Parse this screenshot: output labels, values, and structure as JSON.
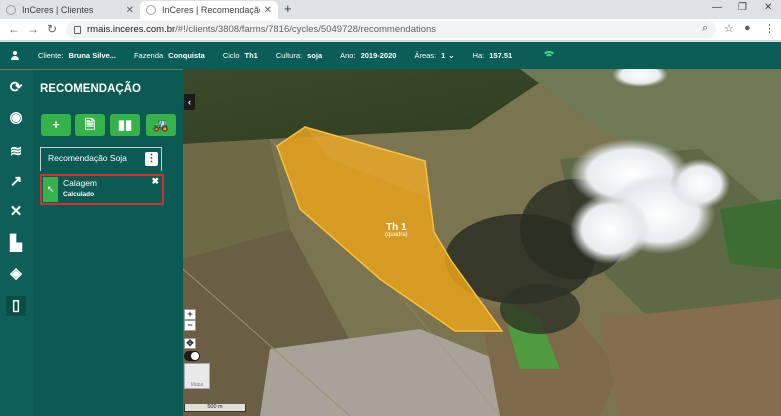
{
  "browser": {
    "tabs": [
      {
        "title": "InCeres | Clientes",
        "active": false
      },
      {
        "title": "InCeres | Recomendação",
        "active": true
      }
    ],
    "url_host": "rmais.inceres.com.br",
    "url_path": "/#!/clients/3808/farms/7816/cycles/5049728/recommendations"
  },
  "topbar": {
    "client_label": "Cliente:",
    "client_value": "Bruna Silve...",
    "farm_label": "Fazenda",
    "farm_value": "Conquista",
    "cycle_label": "Ciclo",
    "cycle_value": "Th1",
    "culture_label": "Cultura:",
    "culture_value": "soja",
    "year_label": "Ano:",
    "year_value": "2019-2020",
    "areas_label": "Áreas:",
    "areas_value": "1",
    "ha_label": "Ha:",
    "ha_value": "157.51"
  },
  "panel": {
    "title": "RECOMENDAÇÃO",
    "tool_buttons": [
      {
        "icon": "plus-icon",
        "glyph": "+"
      },
      {
        "icon": "document-icon",
        "glyph": "🗎"
      },
      {
        "icon": "books-icon",
        "glyph": "▮▮"
      },
      {
        "icon": "tractor-icon",
        "glyph": "🚜"
      }
    ],
    "recommendation_group": "Recomendação Soja",
    "item": {
      "name": "Calagem",
      "status": "Calculado"
    }
  },
  "map": {
    "field_name": "Th 1",
    "field_sub": "(quadra)",
    "scale_label": "500 m",
    "basemap_label": "Mapa",
    "field_color": "#e8a21c"
  },
  "colors": {
    "header_bg": "#0b5e57",
    "panel_bg": "#0b5a53",
    "accent_green": "#35b34a",
    "highlight_red": "#d22f2f"
  }
}
